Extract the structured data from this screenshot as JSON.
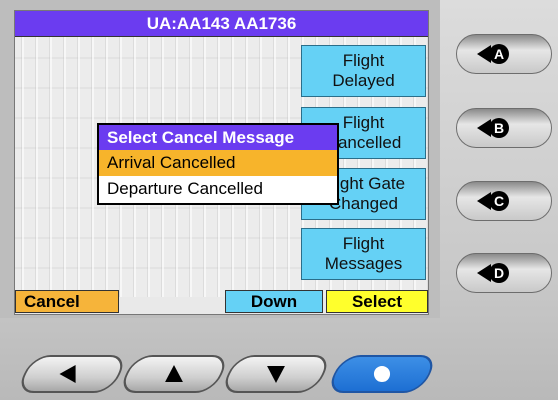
{
  "header": {
    "title": "UA:AA143  AA1736"
  },
  "side_menu": [
    {
      "line1": "Flight",
      "line2": "Delayed"
    },
    {
      "line1": "Flight",
      "line2": "Cancelled"
    },
    {
      "line1": "Flight Gate",
      "line2": "Changed"
    },
    {
      "line1": "Flight",
      "line2": "Messages"
    }
  ],
  "popup": {
    "title": "Select Cancel Message",
    "options": [
      "Arrival Cancelled",
      "Departure Cancelled"
    ],
    "selected_index": 0
  },
  "softkeys": {
    "cancel": "Cancel",
    "down": "Down",
    "select": "Select"
  },
  "round_buttons": [
    "A",
    "B",
    "C",
    "D"
  ],
  "nav_buttons": [
    "left-arrow-icon",
    "up-arrow-icon",
    "down-arrow-icon",
    "circle-icon"
  ],
  "colors": {
    "title_bar": "#6b3cf0",
    "menu_button": "#65d1f5",
    "selected_option": "#f7b42b",
    "select_key": "#ffff2c",
    "cancel_key": "#f6b43a",
    "ok_button": "#1d6fd3"
  }
}
